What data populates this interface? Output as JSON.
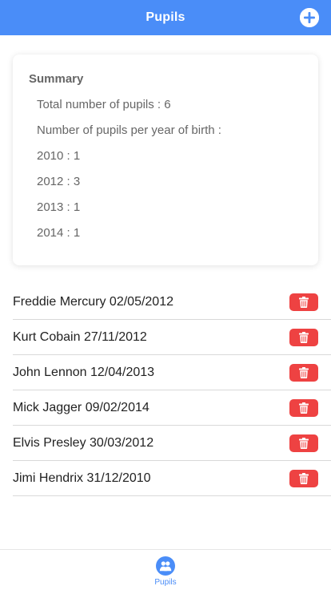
{
  "header": {
    "title": "Pupils",
    "add_icon": "plus-circle-icon",
    "accent_color": "#4a8df8"
  },
  "summary": {
    "title": "Summary",
    "total_line": "Total number of pupils : 6",
    "per_year_heading": "Number of pupils per year of birth :",
    "years": [
      "2010 : 1",
      "2012 : 3",
      "2013 : 1",
      "2014 : 1"
    ]
  },
  "pupils": [
    {
      "label": "Freddie Mercury 02/05/2012"
    },
    {
      "label": "Kurt Cobain 27/11/2012"
    },
    {
      "label": "John Lennon 12/04/2013"
    },
    {
      "label": "Mick Jagger 09/02/2014"
    },
    {
      "label": "Elvis Presley 30/03/2012"
    },
    {
      "label": "Jimi Hendrix 31/12/2010"
    }
  ],
  "delete_icon": "trash-icon",
  "delete_color": "#ee4242",
  "tabbar": {
    "items": [
      {
        "label": "Pupils",
        "icon": "people-icon",
        "active": true
      }
    ]
  }
}
